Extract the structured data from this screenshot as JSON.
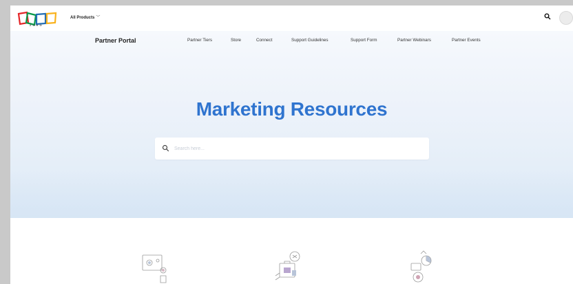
{
  "header": {
    "logo_text": "ZOHO",
    "all_products_label": "All Products",
    "search_icon": "search-icon",
    "avatar_icon": "avatar"
  },
  "subnav": {
    "title": "Partner Portal",
    "links": [
      "Partner Tiers",
      "Store",
      "Connect",
      "Support Guidelines",
      "Support Form",
      "Partner Webinars",
      "Partner Events"
    ]
  },
  "hero": {
    "heading": "Marketing Resources",
    "search_placeholder": "Search here...",
    "heading_color": "#2f74cf"
  },
  "colors": {
    "zoho_red": "#e42527",
    "zoho_green": "#089949",
    "zoho_blue": "#226db4",
    "zoho_yellow": "#f9b21d"
  }
}
